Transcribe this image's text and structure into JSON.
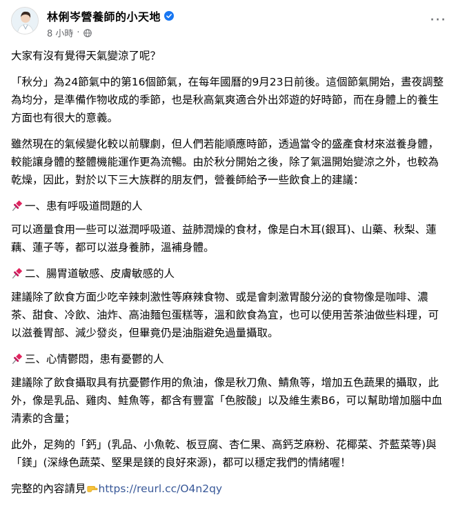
{
  "header": {
    "author": "林俐岑營養師的小天地",
    "time": "8 小時",
    "separator": "·",
    "more_label": "···"
  },
  "icons": {
    "avatar": "avatar-photo",
    "verified": "verified-badge-icon",
    "audience": "globe-icon",
    "bullet": "pushpin-icon",
    "pointer": "pointing-hand-icon"
  },
  "colors": {
    "verified": "#1877f2",
    "link": "#385898",
    "meta": "#65676b",
    "pin": "#e0245e"
  },
  "post": {
    "intro": "大家有沒有覺得天氣變涼了呢？",
    "p1": "「秋分」為24節氣中的第16個節氣，在每年國曆的9月23日前後。這個節氣開始，晝夜調整為均分，是準備作物收成的季節，也是秋高氣爽適合外出郊遊的好時節，而在身體上的養生方面也有很大的意義。",
    "p2": "雖然現在的氣候變化較以前驟劇，但人們若能順應時節，透過當令的盛產食材來滋養身體，較能讓身體的整體機能運作更為流暢。由於秋分開始之後，除了氣溫開始變涼之外，也較為乾燥，因此，對於以下三大族群的朋友們，營養師給予一些飲食上的建議：",
    "h1": "一、患有呼吸道問題的人",
    "p3": "可以適量食用一些可以滋潤呼吸道、益肺潤燥的食材，像是白木耳(銀耳)、山藥、秋梨、蓮藕、蓮子等，都可以滋身養肺，溫補身體。",
    "h2": "二、腸胃道敏感、皮膚敏感的人",
    "p4": "建議除了飲食方面少吃辛辣刺激性等麻辣食物、或是會刺激胃酸分泌的食物像是咖啡、濃茶、甜食、冷飲、油炸、高油麵包蛋糕等，溫和飲食為宜，也可以使用苦茶油做些料理，可以滋養胃部、減少發炎，但畢竟仍是油脂避免過量攝取。",
    "h3": "三、心情鬱悶，患有憂鬱的人",
    "p5": "建議除了飲食攝取具有抗憂鬱作用的魚油，像是秋刀魚、鯖魚等，增加五色蔬果的攝取，此外，像是乳品、雞肉、鮭魚等，都含有豐富「色胺酸」以及維生素B6，可以幫助增加腦中血清素的含量；",
    "p6": "此外，足夠的「鈣」(乳品、小魚乾、板豆腐、杏仁果、高鈣芝麻粉、花椰菜、芥藍菜等)與「鎂」(深綠色蔬菜、堅果是鎂的良好來源)，都可以穩定我們的情緒喔！",
    "outro_text": "完整的內容請見",
    "link": "https://reurl.cc/O4n2qy"
  }
}
